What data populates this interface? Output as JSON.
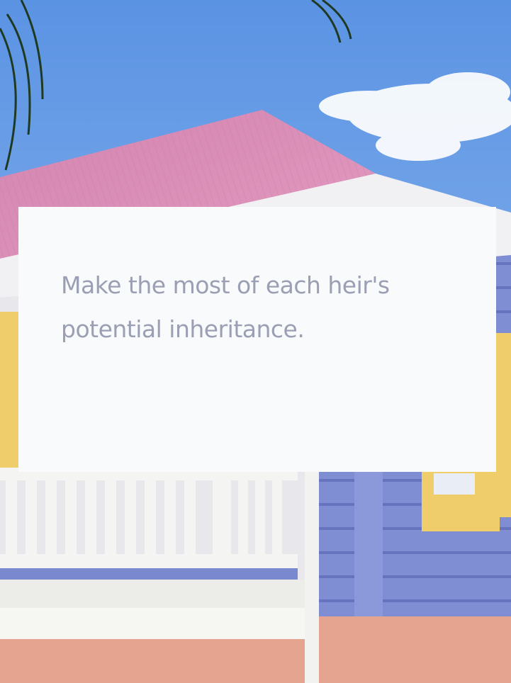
{
  "hero": {
    "image_description": "Colorful Caribbean-style building with a pink corrugated roof, white wooden balcony railing, lavender-blue clapboard siding, yellow shutters, palm fronds against a blue sky",
    "colors": {
      "sky": "#6fa3e8",
      "roof": "#d98ab2",
      "siding": "#7f8ed3",
      "railing": "#f4f4f2",
      "shutter": "#efcd6a",
      "base_wall": "#e5a48f",
      "card_bg": "#f9fafc",
      "headline_text": "#9a9fb3"
    }
  },
  "card": {
    "headline": "Make the most of each heir's potential inheritance."
  }
}
